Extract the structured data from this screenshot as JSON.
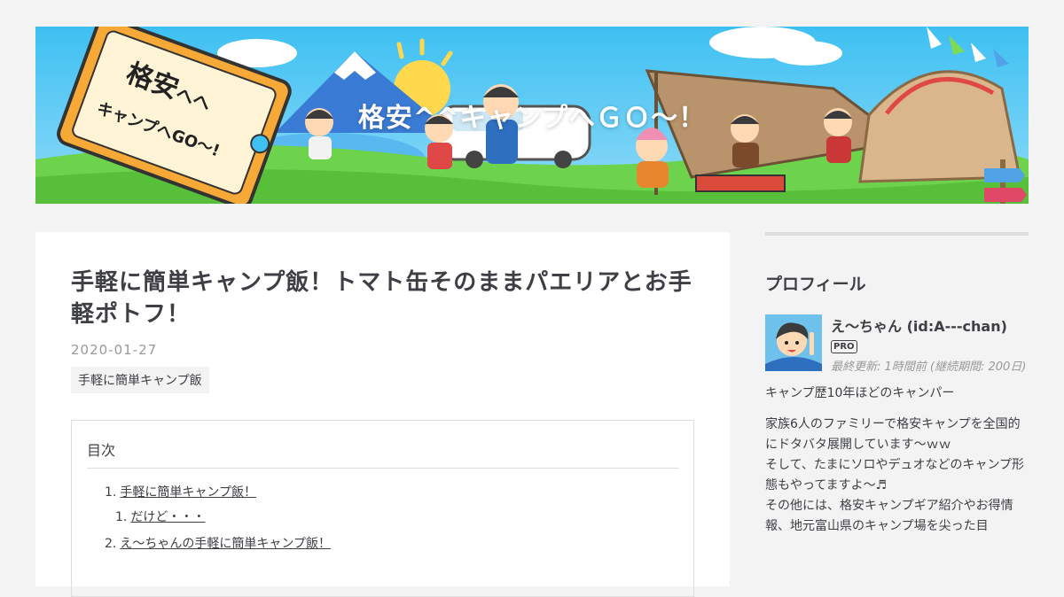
{
  "header": {
    "blog_title": "格安^^キャンプへＧＯ～！",
    "sign_text_1": "格安",
    "sign_text_2": "キャンプへGO～!"
  },
  "entry": {
    "title": "手軽に簡単キャンプ飯！トマト缶そのままパエリアとお手軽ポトフ！",
    "date": "2020-01-27",
    "category": "手軽に簡単キャンプ飯"
  },
  "toc": {
    "title": "目次",
    "items": [
      {
        "num": "1.",
        "label": "手軽に簡単キャンプ飯！",
        "sub_num": "1.",
        "sub_label": "だけど・・・"
      },
      {
        "num": "2.",
        "label": "え～ちゃんの手軽に簡単キャンプ飯！"
      }
    ]
  },
  "sidebar": {
    "profile_title": "プロフィール",
    "name": "え～ちゃん (id:A---chan)",
    "badge": "PRO",
    "updated": "最終更新: 1時間前 (継続期間: 200日)",
    "desc_1": "キャンプ歴10年ほどのキャンパー",
    "desc_2": "家族6人のファミリーで格安キャンプを全国的にドタバタ展開しています～ｗｗ",
    "desc_3": "そして、たまにソロやデュオなどのキャンプ形態もやってますよ～♬",
    "desc_4": "その他には、格安キャンプギア紹介やお得情報、地元富山県のキャンプ場を尖った目"
  },
  "colors": {
    "background": "#f3f3f3",
    "card": "#ffffff",
    "text": "#3d3f44",
    "muted": "#999999",
    "header_sky": "#4fc3f7"
  },
  "icons": [
    "profile-avatar-icon",
    "mount-fuji-icon",
    "sun-icon",
    "tent-icon"
  ]
}
